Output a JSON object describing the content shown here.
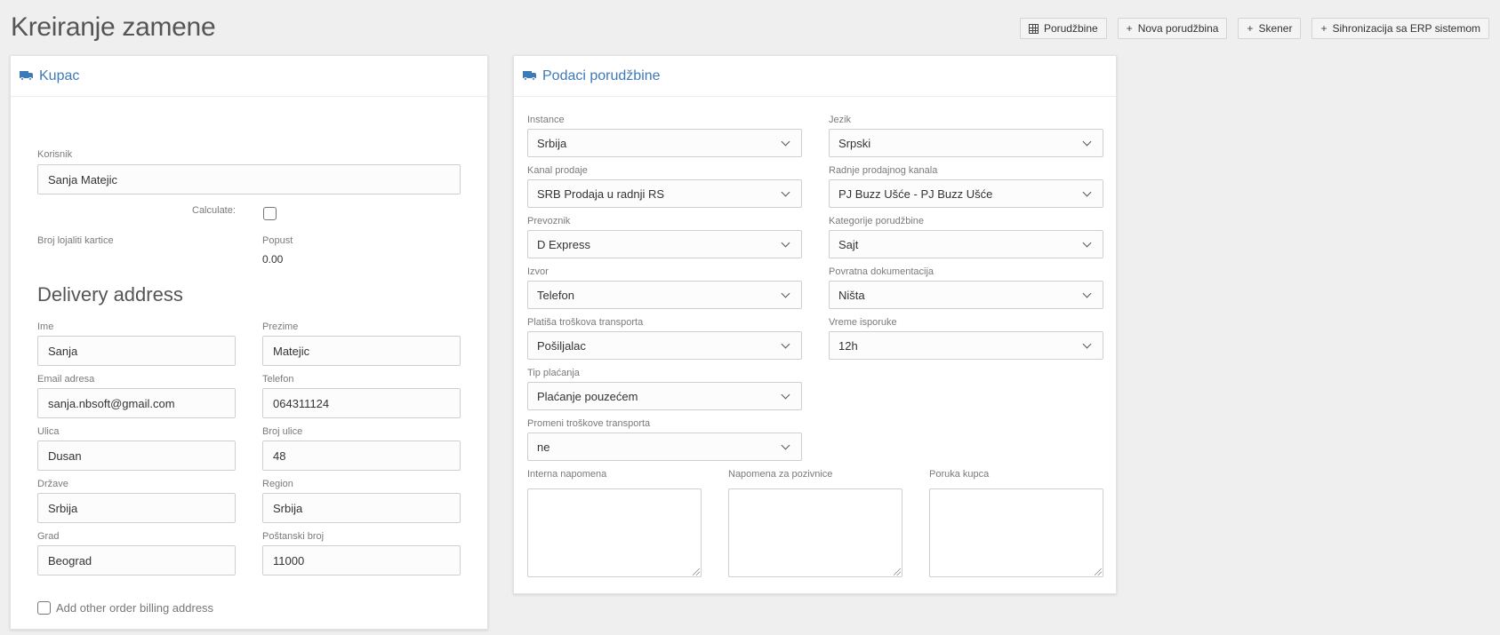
{
  "page": {
    "title": "Kreiranje zamene"
  },
  "toolbar": {
    "orders": "Porudžbine",
    "new_order": "Nova porudžbina",
    "scanner": "Skener",
    "erp_sync": "Sihronizacija sa ERP sistemom"
  },
  "customer": {
    "title": "Kupac",
    "user_label": "Korisnik",
    "user_value": "Sanja Matejic",
    "calculate_label": "Calculate:",
    "loyalty_label": "Broj lojaliti kartice",
    "discount_label": "Popust",
    "discount_value": "0.00",
    "delivery_heading": "Delivery address",
    "fields": {
      "first_name": {
        "label": "Ime",
        "value": "Sanja"
      },
      "last_name": {
        "label": "Prezime",
        "value": "Matejic"
      },
      "email": {
        "label": "Email adresa",
        "value": "sanja.nbsoft@gmail.com"
      },
      "phone": {
        "label": "Telefon",
        "value": "064311124"
      },
      "street": {
        "label": "Ulica",
        "value": "Dusan"
      },
      "street_no": {
        "label": "Broj ulice",
        "value": "48"
      },
      "country": {
        "label": "Države",
        "value": "Srbija"
      },
      "region": {
        "label": "Region",
        "value": "Srbija"
      },
      "city": {
        "label": "Grad",
        "value": "Beograd"
      },
      "postal": {
        "label": "Poštanski broj",
        "value": "11000"
      }
    },
    "billing_label": "Add other order billing address"
  },
  "order": {
    "title": "Podaci porudžbine",
    "instance": {
      "label": "Instance",
      "value": "Srbija"
    },
    "language": {
      "label": "Jezik",
      "value": "Srpski"
    },
    "channel": {
      "label": "Kanal prodaje",
      "value": "SRB Prodaja u radnji RS"
    },
    "store": {
      "label": "Radnje prodajnog kanala",
      "value": "PJ Buzz Ušće - PJ Buzz Ušće"
    },
    "carrier": {
      "label": "Prevoznik",
      "value": "D Express"
    },
    "category": {
      "label": "Kategorije porudžbine",
      "value": "Sajt"
    },
    "source": {
      "label": "Izvor",
      "value": "Telefon"
    },
    "return_docs": {
      "label": "Povratna dokumentacija",
      "value": "Ništa"
    },
    "transport_payer": {
      "label": "Platiša troškova transporta",
      "value": "Pošiljalac"
    },
    "delivery_time": {
      "label": "Vreme isporuke",
      "value": "12h"
    },
    "payment_type": {
      "label": "Tip plaćanja",
      "value": "Plaćanje pouzećem"
    },
    "change_transport": {
      "label": "Promeni troškove transporta",
      "value": "ne"
    },
    "internal_note_label": "Interna napomena",
    "invite_note_label": "Napomena za pozivnice",
    "customer_message_label": "Poruka kupca"
  }
}
